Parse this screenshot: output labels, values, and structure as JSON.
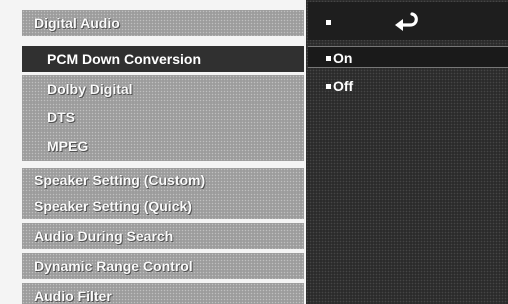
{
  "menu": {
    "items": [
      {
        "label": "Digital Audio"
      },
      {
        "label": "PCM Down Conversion"
      },
      {
        "label": "Dolby Digital"
      },
      {
        "label": "DTS"
      },
      {
        "label": "MPEG"
      },
      {
        "label": "Speaker Setting (Custom)"
      },
      {
        "label": "Speaker Setting (Quick)"
      },
      {
        "label": "Audio  During Search"
      },
      {
        "label": "Dynamic Range Control"
      },
      {
        "label": "Audio Filter"
      }
    ]
  },
  "options": {
    "header_icon": "return-arrow-icon",
    "items": [
      {
        "label": "On",
        "selected": true
      },
      {
        "label": "Off",
        "selected": false
      }
    ]
  },
  "colors": {
    "menu_gray": "#9c9c9c",
    "selected_dark": "#303030",
    "panel_dark": "#2b2b2b",
    "text_white": "#ffffff"
  }
}
